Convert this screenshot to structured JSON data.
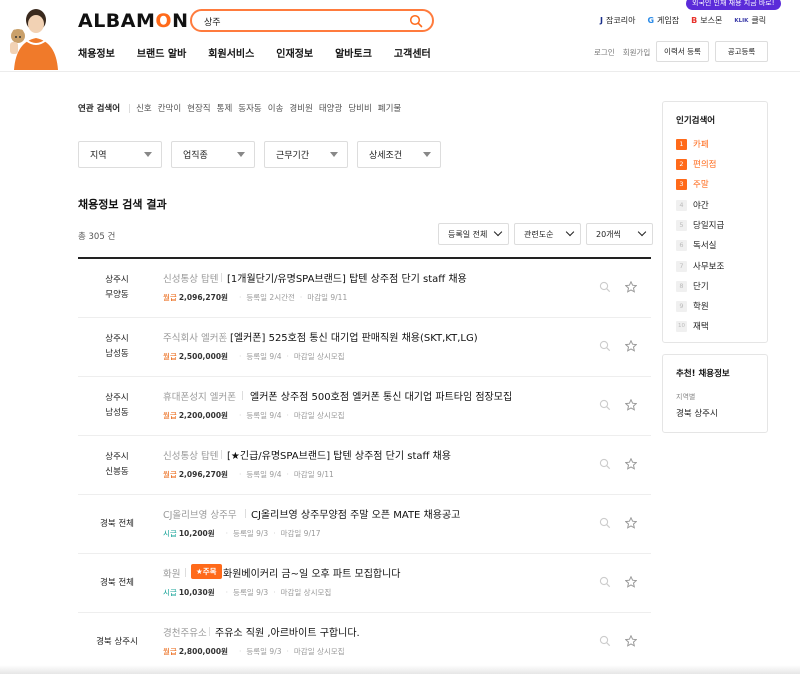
{
  "header": {
    "logo_main": "ALBAM",
    "logo_accent": "O",
    "logo_end": "N",
    "search_value": "상주",
    "promo": "외국인 인재 채용 지금 바로!",
    "sites": [
      {
        "icon": "J",
        "label": "잡코리아",
        "color": "#1a2f8a"
      },
      {
        "icon": "G",
        "label": "게임잡",
        "color": "#2b8be8"
      },
      {
        "icon": "B",
        "label": "보스몬",
        "color": "#e8322b"
      },
      {
        "icon": "KLIK",
        "label": "클릭",
        "color": "#3a3aa8"
      }
    ],
    "nav": [
      "채용정보",
      "브랜드 알바",
      "회원서비스",
      "인재정보",
      "알바토크",
      "고객센터"
    ],
    "login": "로그인",
    "join": "회원가입",
    "resume_btn": "이력서 등록",
    "post_btn": "공고등록"
  },
  "related": {
    "label": "연관 검색어",
    "words": [
      "신호",
      "칸막이",
      "현장직",
      "통제",
      "동자동",
      "이송",
      "경비원",
      "태양광",
      "당비비",
      "폐기물"
    ]
  },
  "filters": [
    "지역",
    "업직종",
    "근무기간",
    "상세조건"
  ],
  "results": {
    "title": "채용정보 검색 결과",
    "total": "총 305 건",
    "sorts": [
      "등록일 전체",
      "관련도순",
      "20개씩"
    ]
  },
  "jobs": [
    {
      "loc1": "상주시",
      "loc2": "무양동",
      "company": "신성통상 탑텐",
      "badge": "",
      "title": "[1개월단기/유명SPA브랜드] 탑텐 상주점 단기 staff 채용",
      "pay_label": "월급",
      "pay_type": "month",
      "pay": "2,096,270원",
      "reg": "등록일 2시간전",
      "due": "마감일 9/11"
    },
    {
      "loc1": "상주시",
      "loc2": "남성동",
      "company": "주식회사 엘커폰",
      "badge": "",
      "title": "[엘커폰] 525호점 통신 대기업 판매직원 채용(SKT,KT,LG)",
      "pay_label": "월급",
      "pay_type": "month",
      "pay": "2,500,000원",
      "reg": "등록일 9/4",
      "due": "마감일 상시모집"
    },
    {
      "loc1": "상주시",
      "loc2": "남성동",
      "company": "휴대폰성지 엘커폰",
      "badge": "",
      "title": "엘커폰 상주점 500호점 엘커폰 통신 대기업 파트타임 점장모집",
      "pay_label": "월급",
      "pay_type": "month",
      "pay": "2,200,000원",
      "reg": "등록일 9/4",
      "due": "마감일 상시모집"
    },
    {
      "loc1": "상주시",
      "loc2": "신봉동",
      "company": "신성통상 탑텐",
      "badge": "",
      "title": "[★긴급/유명SPA브랜드] 탑텐 상주점 단기 staff 채용",
      "pay_label": "월급",
      "pay_type": "month",
      "pay": "2,096,270원",
      "reg": "등록일 9/4",
      "due": "마감일 9/11"
    },
    {
      "loc1": "경북 전체",
      "loc2": "",
      "company": "CJ올리브영 상주무",
      "badge": "",
      "title": "CJ올리브영 상주무양점 주말 오픈 MATE 채용공고",
      "pay_label": "시급",
      "pay_type": "hour",
      "pay": "10,200원",
      "reg": "등록일 9/3",
      "due": "마감일 9/17"
    },
    {
      "loc1": "경북 전체",
      "loc2": "",
      "company": "화원",
      "badge": "★주목",
      "title": "화원베이커리 금~일 오후 파트 모집합니다",
      "pay_label": "시급",
      "pay_type": "hour",
      "pay": "10,030원",
      "reg": "등록일 9/3",
      "due": "마감일 상시모집"
    },
    {
      "loc1": "경북 상주시",
      "loc2": "",
      "company": "경천주유소",
      "badge": "",
      "title": "주유소 직원 ,아르바이트 구합니다.",
      "pay_label": "월급",
      "pay_type": "month",
      "pay": "2,800,000원",
      "reg": "등록일 9/3",
      "due": "마감일 상시모집"
    }
  ],
  "popular": {
    "title": "인기검색어",
    "items": [
      {
        "n": "1",
        "label": "카페"
      },
      {
        "n": "2",
        "label": "편의점"
      },
      {
        "n": "3",
        "label": "주말"
      },
      {
        "n": "4",
        "label": "야간"
      },
      {
        "n": "5",
        "label": "당일지급"
      },
      {
        "n": "6",
        "label": "독서실"
      },
      {
        "n": "7",
        "label": "사무보조"
      },
      {
        "n": "8",
        "label": "단기"
      },
      {
        "n": "9",
        "label": "학원"
      },
      {
        "n": "10",
        "label": "재택"
      }
    ]
  },
  "recommend": {
    "title": "추천! 채용정보",
    "sub": "지역별",
    "value": "경북 상주시"
  },
  "colors": {
    "accent": "#ff6a1a",
    "hourly": "#17a398",
    "promo": "#5b2bd9"
  }
}
